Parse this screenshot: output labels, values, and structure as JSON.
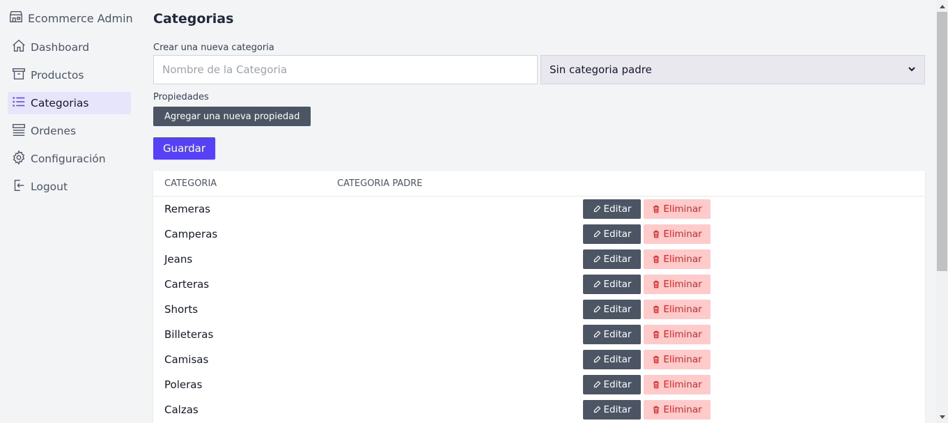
{
  "app": {
    "title": "Ecommerce Admin"
  },
  "sidebar": {
    "items": [
      {
        "label": "Dashboard",
        "icon": "home-icon"
      },
      {
        "label": "Productos",
        "icon": "archive-box-icon"
      },
      {
        "label": "Categorias",
        "icon": "list-icon",
        "active": true
      },
      {
        "label": "Ordenes",
        "icon": "queue-list-icon"
      },
      {
        "label": "Configuración",
        "icon": "gear-icon"
      },
      {
        "label": "Logout",
        "icon": "logout-icon"
      }
    ]
  },
  "main": {
    "title": "Categorias",
    "form": {
      "new_label": "Crear una nueva categoria",
      "name_placeholder": "Nombre de la Categoria",
      "name_value": "",
      "parent_selected": "Sin categoria padre",
      "properties_label": "Propiedades",
      "add_property_label": "Agregar una nueva propiedad",
      "save_label": "Guardar"
    },
    "table": {
      "headers": [
        "CATEGORIA",
        "CATEGORIA PADRE"
      ],
      "edit_label": "Editar",
      "delete_label": "Eliminar",
      "rows": [
        {
          "name": "Remeras",
          "parent": ""
        },
        {
          "name": "Camperas",
          "parent": ""
        },
        {
          "name": "Jeans",
          "parent": ""
        },
        {
          "name": "Carteras",
          "parent": ""
        },
        {
          "name": "Shorts",
          "parent": ""
        },
        {
          "name": "Billeteras",
          "parent": ""
        },
        {
          "name": "Camisas",
          "parent": ""
        },
        {
          "name": "Poleras",
          "parent": ""
        },
        {
          "name": "Calzas",
          "parent": ""
        }
      ]
    }
  },
  "colors": {
    "primary": "#5542f6",
    "dark_button": "#4b5563",
    "delete_bg": "#fecaca",
    "delete_text": "#dc2626",
    "active_nav_bg": "#e7e5fb"
  }
}
